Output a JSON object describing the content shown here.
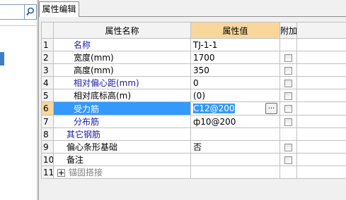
{
  "panel": {
    "tab_label": "属性编辑"
  },
  "grid": {
    "headers": {
      "num": "",
      "name": "属性名称",
      "value": "属性值",
      "add": "附加"
    },
    "rows": [
      {
        "num": "1",
        "name": "名称",
        "value": "TJ-1-1",
        "name_color": "blue",
        "has_checkbox": false
      },
      {
        "num": "2",
        "name": "宽度(mm)",
        "value": "1700",
        "name_color": "black",
        "has_checkbox": true
      },
      {
        "num": "3",
        "name": "高度(mm)",
        "value": "350",
        "name_color": "black",
        "has_checkbox": true
      },
      {
        "num": "4",
        "name": "相对偏心距(mm)",
        "value": "0",
        "name_color": "blue",
        "has_checkbox": true
      },
      {
        "num": "5",
        "name": "相对底标高(m)",
        "value": "(0)",
        "name_color": "black",
        "has_checkbox": true
      },
      {
        "num": "6",
        "name": "受力筋",
        "value": "C12@200",
        "name_color": "blue",
        "has_checkbox": true,
        "selected": true
      },
      {
        "num": "7",
        "name": "分布筋",
        "value": "ф10@200",
        "name_color": "blue",
        "has_checkbox": true
      },
      {
        "num": "8",
        "name": "其它钢筋",
        "value": "",
        "name_color": "blue",
        "has_checkbox": false
      },
      {
        "num": "9",
        "name": "偏心条形基础",
        "value": "否",
        "name_color": "black",
        "has_checkbox": true
      },
      {
        "num": "10",
        "name": "备注",
        "value": "",
        "name_color": "black",
        "has_checkbox": true
      },
      {
        "num": "11",
        "name": "锚固搭接",
        "value": "",
        "name_color": "gray",
        "has_checkbox": false,
        "expandable": true
      }
    ],
    "ellipsis_label": "..."
  },
  "colors": {
    "selection": "#3399ff",
    "header_highlight": "#f9d79a",
    "blue_text": "#1a1aa8"
  },
  "icons": {
    "search": "magnifier-icon"
  }
}
